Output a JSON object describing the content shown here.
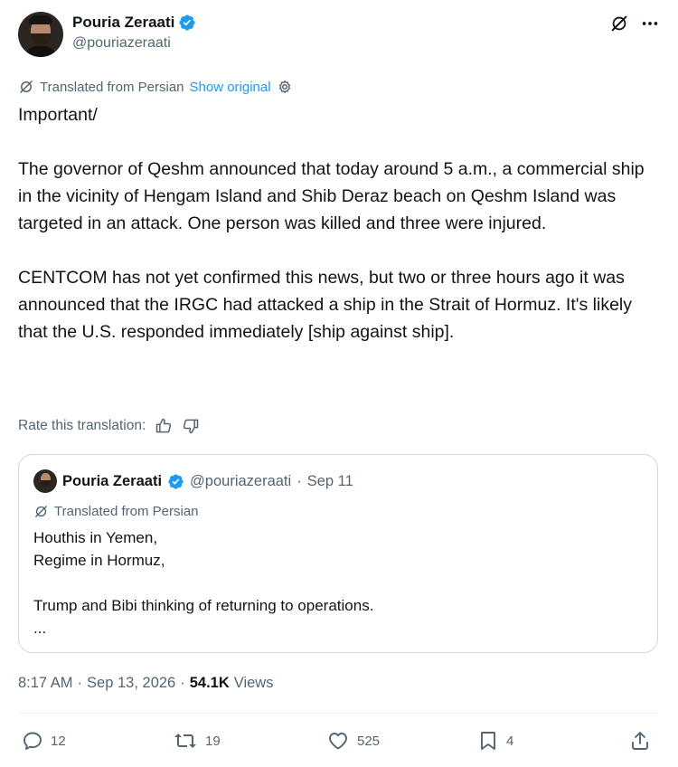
{
  "author": {
    "name": "Pouria Zeraati",
    "handle": "@pouriazeraati"
  },
  "header_icons": [
    "grok-icon",
    "more-icon"
  ],
  "translation": {
    "label": "Translated from Persian",
    "show_original": "Show original"
  },
  "tweet": {
    "text": "Important/\n\nThe governor of Qeshm announced that today around 5 a.m., a commercial ship in the vicinity of Hengam Island and Shib Deraz beach on Qeshm Island was targeted in an attack. One person was killed and three were injured.\n\nCENTCOM has not yet confirmed this news, but two or three hours ago it was announced that the IRGC had attacked a ship in the Strait of Hormuz. It's likely that the U.S. responded immediately [ship against ship]."
  },
  "rate": {
    "label": "Rate this translation:"
  },
  "quote": {
    "name": "Pouria Zeraati",
    "handle": "@pouriazeraati",
    "separator": "·",
    "date": "Sep 11",
    "translated_label": "Translated from Persian",
    "text": "Houthis in Yemen,\nRegime in Hormuz,\n\nTrump and Bibi thinking of returning to operations.\n..."
  },
  "meta": {
    "time": "8:17 AM",
    "separator": "·",
    "date": "Sep 13, 2026",
    "views_count": "54.1K",
    "views_label": "Views"
  },
  "actions": {
    "replies": "12",
    "reposts": "19",
    "likes": "525",
    "bookmarks": "4"
  },
  "colors": {
    "accent": "#1d9bf0",
    "secondary_text": "#536471",
    "primary_text": "#0f1419",
    "border": "#cfd9de"
  }
}
